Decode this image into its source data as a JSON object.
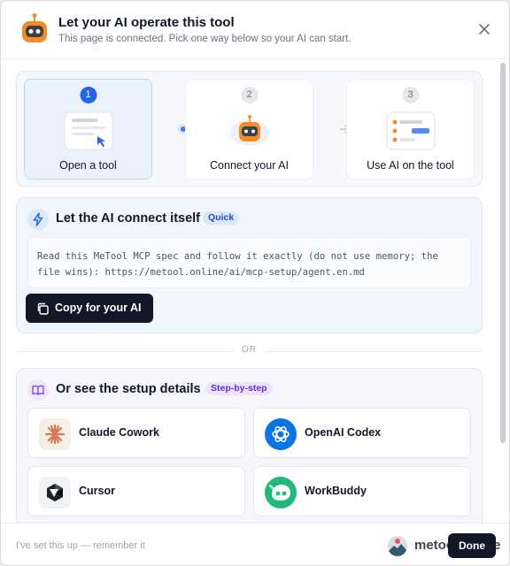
{
  "header": {
    "title": "Let your AI operate this tool",
    "subtitle": "This page is connected. Pick one way below so your AI can start."
  },
  "steps": [
    {
      "number": "1",
      "label": "Open a tool",
      "active": true
    },
    {
      "number": "2",
      "label": "Connect your AI",
      "active": false
    },
    {
      "number": "3",
      "label": "Use AI on the tool",
      "active": false
    }
  ],
  "connect": {
    "title": "Let the AI connect itself",
    "badge": "Quick",
    "spec_line1": "Read this MeTool MCP spec and follow it exactly (do not use memory; the",
    "spec_line2": "file wins): https://metool.online/ai/mcp-setup/agent.en.md",
    "copy_label": "Copy for your AI"
  },
  "divider": {
    "label": "OR"
  },
  "details": {
    "title": "Or see the setup details",
    "badge": "Step-by-step",
    "tools": [
      {
        "name": "Claude Cowork",
        "icon": "claude-icon"
      },
      {
        "name": "OpenAI Codex",
        "icon": "openai-icon"
      },
      {
        "name": "Cursor",
        "icon": "cursor-icon"
      },
      {
        "name": "WorkBuddy",
        "icon": "workbuddy-icon"
      }
    ]
  },
  "footer": {
    "remember": "I've set this up — remember it",
    "brand": "metool.online",
    "done_label": "Done"
  },
  "colors": {
    "accent": "#2563eb",
    "dark_button": "#111827",
    "robot_orange": "#f28c28"
  }
}
